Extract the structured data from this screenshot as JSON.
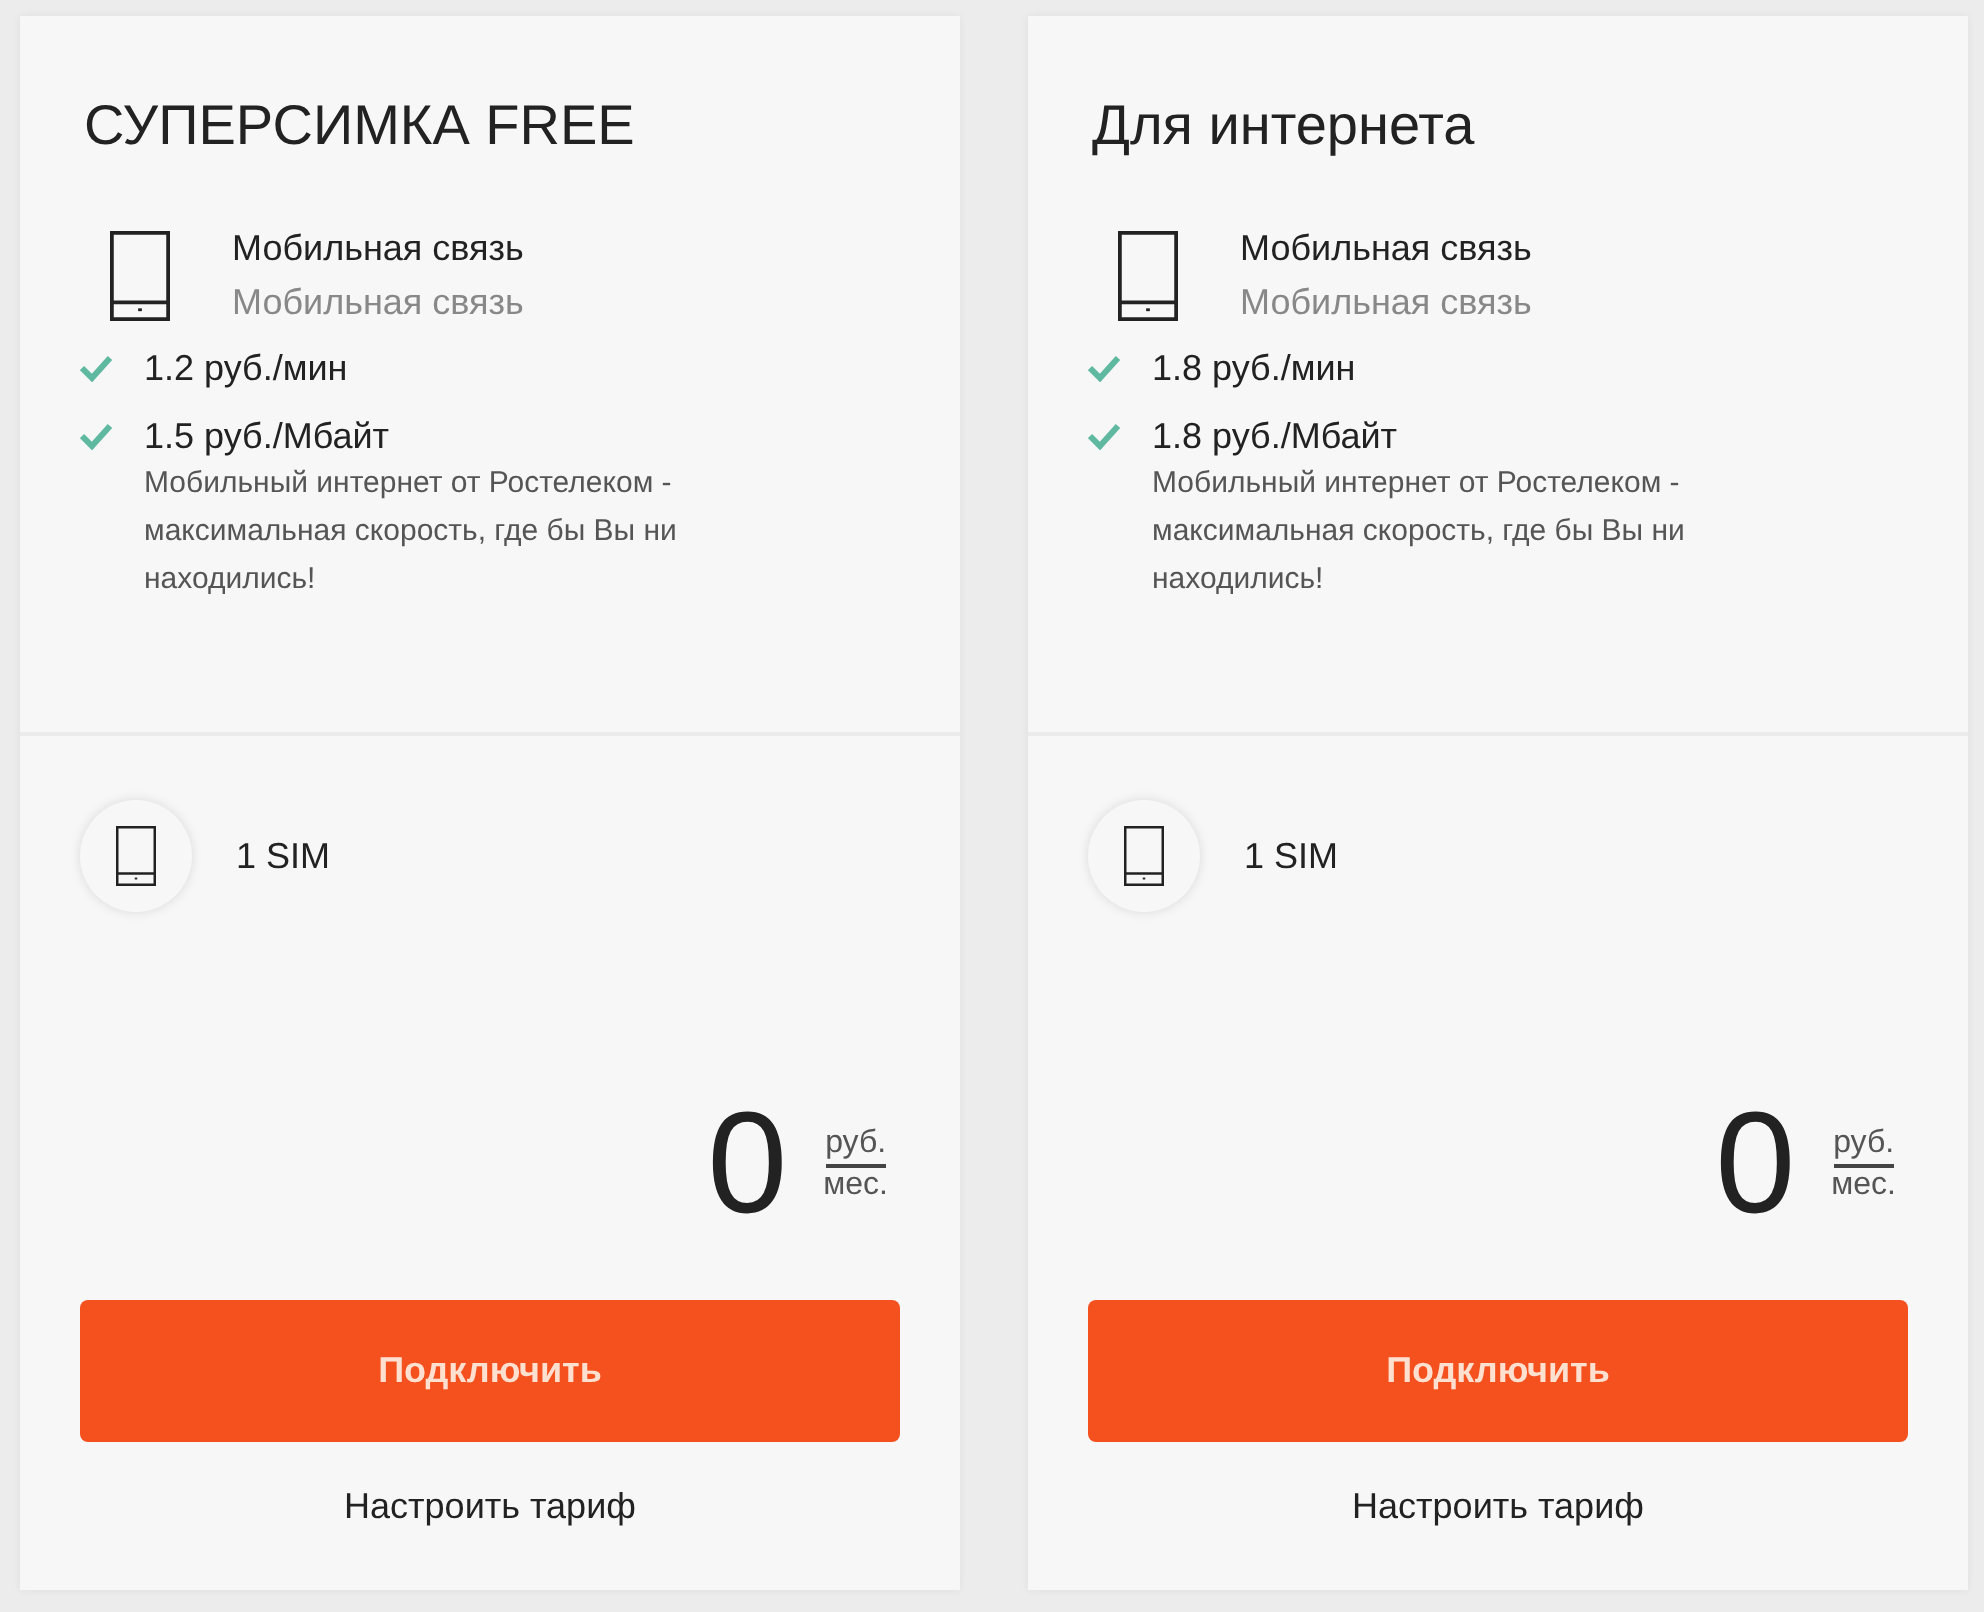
{
  "tariffs": [
    {
      "title": "СУПЕРСИМКА FREE",
      "service": {
        "name": "Мобильная связь",
        "subtitle": "Мобильная связь"
      },
      "features": [
        {
          "label": "1.2 руб./мин",
          "checked": true
        },
        {
          "label": "1.5 руб./Мбайт",
          "checked": true,
          "description": "Мобильный интернет от Ростелеком - максимальная скорость, где бы Вы ни находились!"
        }
      ],
      "sim": "1 SIM",
      "price": "0",
      "unit_top": "руб.",
      "unit_bottom": "мес.",
      "connect_button": "Подключить",
      "customize_link": "Настроить тариф"
    },
    {
      "title": "Для интернета",
      "service": {
        "name": "Мобильная связь",
        "subtitle": "Мобильная связь"
      },
      "features": [
        {
          "label": "1.8 руб./мин",
          "checked": true
        },
        {
          "label": "1.8 руб./Мбайт",
          "checked": true,
          "description": "Мобильный интернет от Ростелеком - максимальная скорость, где бы Вы ни находились!"
        }
      ],
      "sim": "1 SIM",
      "price": "0",
      "unit_top": "руб.",
      "unit_bottom": "мес.",
      "connect_button": "Подключить",
      "customize_link": "Настроить тариф"
    }
  ]
}
